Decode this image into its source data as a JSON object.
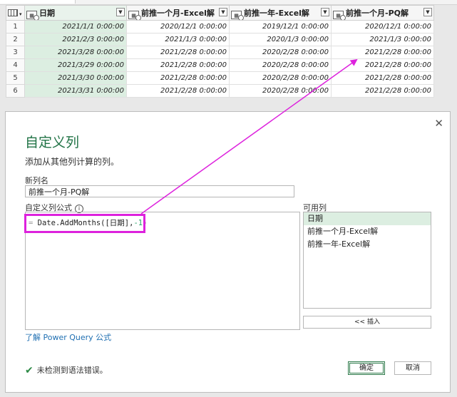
{
  "grid": {
    "corner_icon": "table-icon",
    "columns": [
      {
        "label": "日期"
      },
      {
        "label": "前推一个月-Excel解"
      },
      {
        "label": "前推一年-Excel解"
      },
      {
        "label": "前推一个月-PQ解"
      }
    ],
    "rows": [
      {
        "num": "1",
        "cells": [
          "2021/1/1 0:00:00",
          "2020/12/1 0:00:00",
          "2019/12/1 0:00:00",
          "2020/12/1 0:00:00"
        ]
      },
      {
        "num": "2",
        "cells": [
          "2021/2/3 0:00:00",
          "2021/1/3 0:00:00",
          "2020/1/3 0:00:00",
          "2021/1/3 0:00:00"
        ]
      },
      {
        "num": "3",
        "cells": [
          "2021/3/28 0:00:00",
          "2021/2/28 0:00:00",
          "2020/2/28 0:00:00",
          "2021/2/28 0:00:00"
        ]
      },
      {
        "num": "4",
        "cells": [
          "2021/3/29 0:00:00",
          "2021/2/28 0:00:00",
          "2020/2/28 0:00:00",
          "2021/2/28 0:00:00"
        ]
      },
      {
        "num": "5",
        "cells": [
          "2021/3/30 0:00:00",
          "2021/2/28 0:00:00",
          "2020/2/28 0:00:00",
          "2021/2/28 0:00:00"
        ]
      },
      {
        "num": "6",
        "cells": [
          "2021/3/31 0:00:00",
          "2021/2/28 0:00:00",
          "2020/2/28 0:00:00",
          "2021/2/28 0:00:00"
        ]
      }
    ]
  },
  "dialog": {
    "close": "✕",
    "title": "自定义列",
    "subtitle": "添加从其他列计算的列。",
    "name_label": "新列名",
    "name_value": "前推一个月-PQ解",
    "formula_label": "自定义列公式",
    "info_icon": "i",
    "formula_prefix": "=",
    "formula_func": "Date.AddMonths([日期],",
    "formula_num": "-1",
    "formula_close": ")",
    "available_label": "可用列",
    "available_columns": [
      "日期",
      "前推一个月-Excel解",
      "前推一年-Excel解"
    ],
    "insert_label": "<< 插入",
    "learn_link": "了解 Power Query 公式",
    "status_text": "未检测到语法错误。",
    "ok_label": "确定",
    "cancel_label": "取消"
  },
  "colors": {
    "accent_green": "#217346",
    "selected_col": "#dceee1",
    "annotation": "#dd22dd"
  }
}
